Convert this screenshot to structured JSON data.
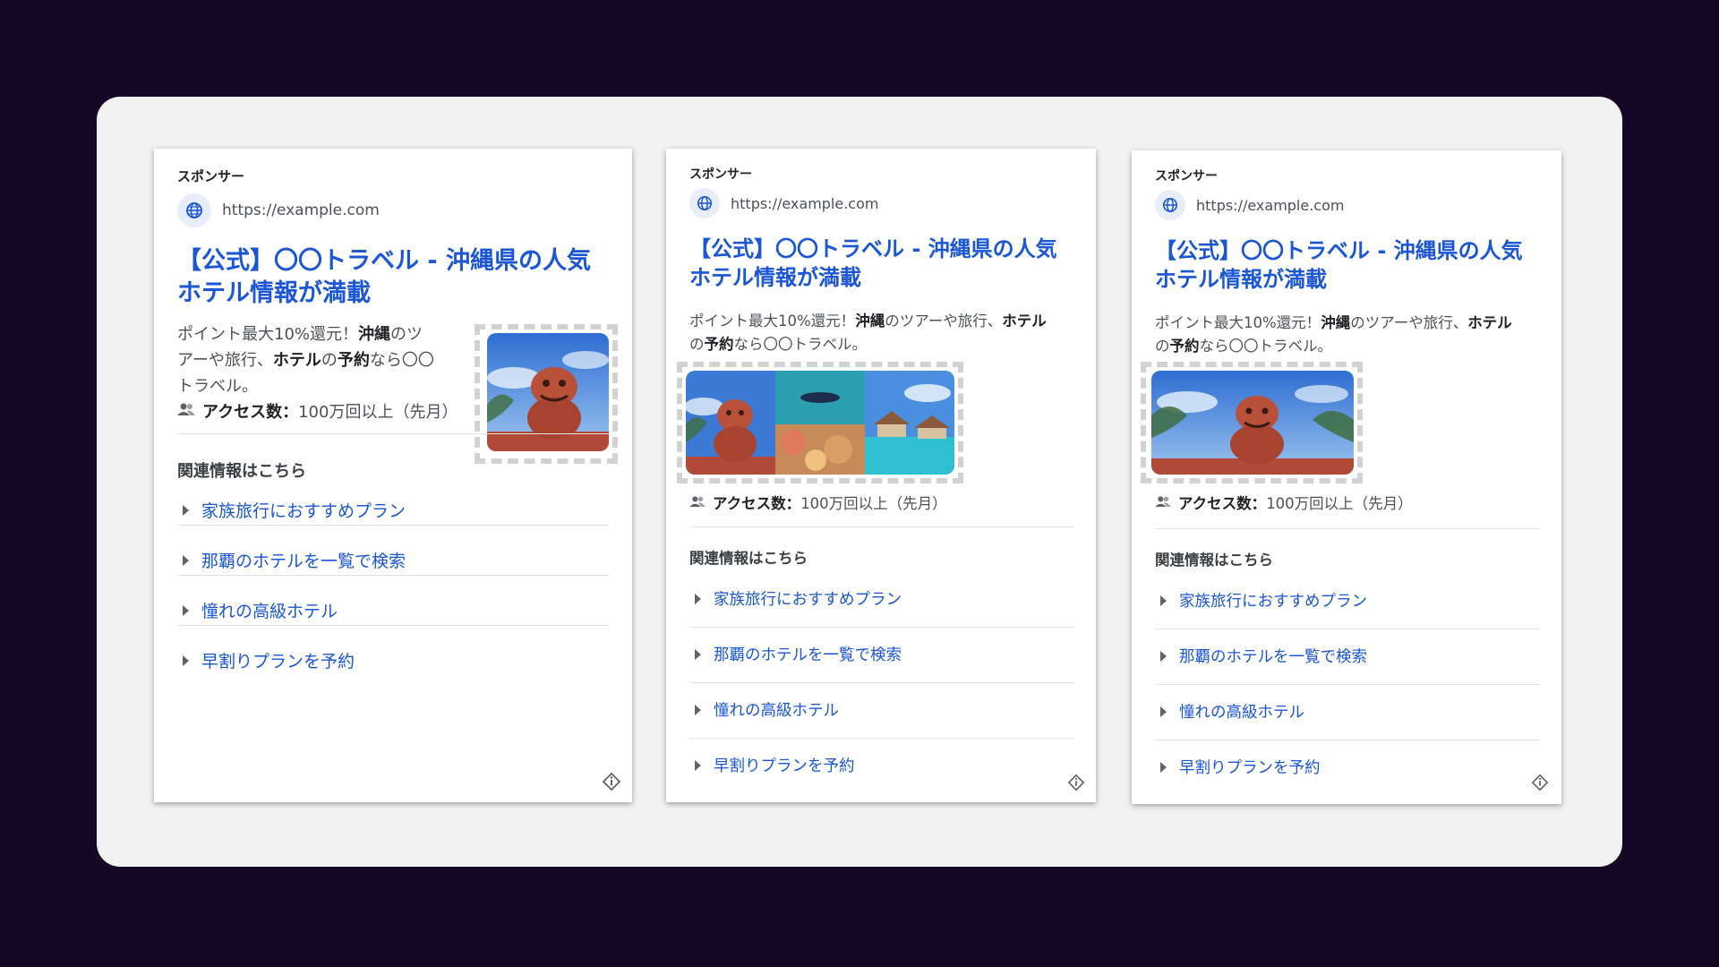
{
  "cards": [
    {
      "sponsor": "スポンサー",
      "url": "https://example.com",
      "title_line1": "【公式】〇〇トラベル - 沖縄県の人気",
      "title_line2": "ホテル情報が満載",
      "desc_line1_pre": "ポイント最大10%還元！",
      "desc_line1_bold": "沖縄",
      "desc_line1_post": "のツ",
      "desc_line2_pre": "アーや旅行、",
      "desc_line2_bold1": "ホテル",
      "desc_line2_mid": "の",
      "desc_line2_bold2": "予約",
      "desc_line2_post": "なら〇〇",
      "desc_line3": "トラベル。",
      "access_label": "アクセス数：",
      "access_value": "100万回以上（先月）",
      "related_heading": "関連情報はこちら",
      "links": [
        "家族旅行におすすめプラン",
        "那覇のホテルを一覧で検索",
        "憧れの高級ホテル",
        "早割りプランを予約"
      ]
    },
    {
      "sponsor": "スポンサー",
      "url": "https://example.com",
      "title_line1": "【公式】〇〇トラベル - 沖縄県の人気",
      "title_line2": "ホテル情報が満載",
      "desc_line1_pre": "ポイント最大10%還元！",
      "desc_line1_bold": "沖縄",
      "desc_line1_mid": "のツアーや旅行、",
      "desc_line1_bold2": "ホテル",
      "desc_line2_pre": "の",
      "desc_line2_bold": "予約",
      "desc_line2_post": "なら〇〇トラベル。",
      "access_label": "アクセス数：",
      "access_value": "100万回以上（先月）",
      "related_heading": "関連情報はこちら",
      "links": [
        "家族旅行におすすめプラン",
        "那覇のホテルを一覧で検索",
        "憧れの高級ホテル",
        "早割りプランを予約"
      ]
    },
    {
      "sponsor": "スポンサー",
      "url": "https://example.com",
      "title_line1": "【公式】〇〇トラベル - 沖縄県の人気",
      "title_line2": "ホテル情報が満載",
      "desc_line1_pre": "ポイント最大10%還元！",
      "desc_line1_bold": "沖縄",
      "desc_line1_mid": "のツアーや旅行、",
      "desc_line1_bold2": "ホテル",
      "desc_line2_pre": "の",
      "desc_line2_bold": "予約",
      "desc_line2_post": "なら〇〇トラベル。",
      "access_label": "アクセス数：",
      "access_value": "100万回以上（先月）",
      "related_heading": "関連情報はこちら",
      "links": [
        "家族旅行におすすめプラン",
        "那覇のホテルを一覧で検索",
        "憧れの高級ホテル",
        "早割りプランを予約"
      ]
    }
  ],
  "icons": {
    "globe": "globe-icon",
    "people": "people-icon",
    "info": "ad-info-icon",
    "chevron": "triangle-right-icon"
  },
  "colors": {
    "background": "#150726",
    "panel": "#f2f2f2",
    "title_link": "#1a56d6",
    "dashed_frame": "#d2d2d2"
  }
}
